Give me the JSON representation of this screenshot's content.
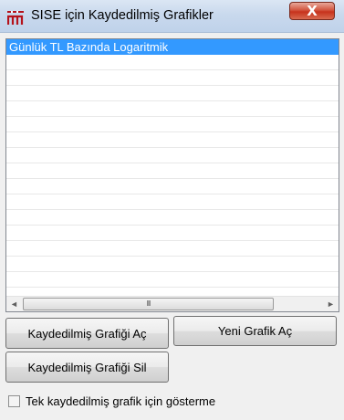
{
  "window": {
    "title": "SISE için Kaydedilmiş Grafikler",
    "close_glyph": "X"
  },
  "list": {
    "items": [
      {
        "label": "Günlük TL Bazında  Logaritmik",
        "selected": true
      },
      {
        "label": ""
      },
      {
        "label": ""
      },
      {
        "label": ""
      },
      {
        "label": ""
      },
      {
        "label": ""
      },
      {
        "label": ""
      },
      {
        "label": ""
      },
      {
        "label": ""
      },
      {
        "label": ""
      },
      {
        "label": ""
      },
      {
        "label": ""
      },
      {
        "label": ""
      },
      {
        "label": ""
      },
      {
        "label": ""
      },
      {
        "label": ""
      },
      {
        "label": ""
      }
    ],
    "scroll_left_glyph": "◄",
    "scroll_right_glyph": "►",
    "scroll_thumb_grip": "III"
  },
  "buttons": {
    "open_label": "Kaydedilmiş Grafiği Aç",
    "new_label": "Yeni Grafik Aç",
    "delete_label": "Kaydedilmiş Grafiği Sil"
  },
  "options": {
    "dont_show_label": "Tek kaydedilmiş grafik için gösterme",
    "dont_show_checked": false
  },
  "colors": {
    "selection": "#3399ff",
    "app_icon": "#b5121b"
  }
}
